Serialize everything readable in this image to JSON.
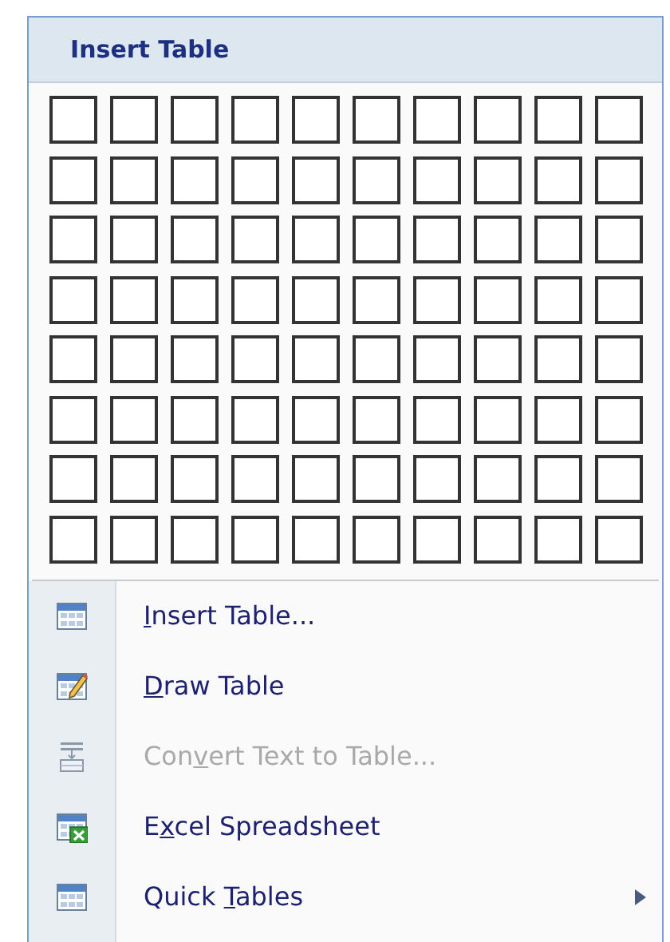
{
  "header": {
    "title": "Insert Table"
  },
  "grid": {
    "rows": [
      {
        "cells": [
          {
            "selected": false
          },
          {
            "selected": false
          },
          {
            "selected": false
          },
          {
            "selected": false
          },
          {
            "selected": false
          },
          {
            "selected": false
          },
          {
            "selected": false
          },
          {
            "selected": false
          },
          {
            "selected": false
          },
          {
            "selected": false
          }
        ]
      },
      {
        "cells": [
          {
            "selected": false
          },
          {
            "selected": false
          },
          {
            "selected": false
          },
          {
            "selected": false
          },
          {
            "selected": false
          },
          {
            "selected": false
          },
          {
            "selected": false
          },
          {
            "selected": false
          },
          {
            "selected": false
          },
          {
            "selected": false
          }
        ]
      },
      {
        "cells": [
          {
            "selected": false
          },
          {
            "selected": false
          },
          {
            "selected": false
          },
          {
            "selected": false
          },
          {
            "selected": false
          },
          {
            "selected": false
          },
          {
            "selected": false
          },
          {
            "selected": false
          },
          {
            "selected": false
          },
          {
            "selected": false
          }
        ]
      },
      {
        "cells": [
          {
            "selected": false
          },
          {
            "selected": false
          },
          {
            "selected": false
          },
          {
            "selected": false
          },
          {
            "selected": false
          },
          {
            "selected": false
          },
          {
            "selected": false
          },
          {
            "selected": false
          },
          {
            "selected": false
          },
          {
            "selected": false
          }
        ]
      },
      {
        "cells": [
          {
            "selected": false
          },
          {
            "selected": false
          },
          {
            "selected": false
          },
          {
            "selected": false
          },
          {
            "selected": false
          },
          {
            "selected": false
          },
          {
            "selected": false
          },
          {
            "selected": false
          },
          {
            "selected": false
          },
          {
            "selected": false
          }
        ]
      },
      {
        "cells": [
          {
            "selected": false
          },
          {
            "selected": false
          },
          {
            "selected": false
          },
          {
            "selected": false
          },
          {
            "selected": false
          },
          {
            "selected": false
          },
          {
            "selected": false
          },
          {
            "selected": false
          },
          {
            "selected": false
          },
          {
            "selected": false
          }
        ]
      },
      {
        "cells": [
          {
            "selected": false
          },
          {
            "selected": false
          },
          {
            "selected": false
          },
          {
            "selected": false
          },
          {
            "selected": false
          },
          {
            "selected": false
          },
          {
            "selected": false
          },
          {
            "selected": false
          },
          {
            "selected": false
          },
          {
            "selected": false
          }
        ]
      },
      {
        "cells": [
          {
            "selected": false
          },
          {
            "selected": false
          },
          {
            "selected": false
          },
          {
            "selected": false
          },
          {
            "selected": false
          },
          {
            "selected": false
          },
          {
            "selected": false
          },
          {
            "selected": false
          },
          {
            "selected": false
          },
          {
            "selected": false
          }
        ]
      }
    ]
  },
  "menu_items": [
    {
      "kind": "insert",
      "access_key": "I",
      "label_after": "nsert Table...",
      "disabled": false,
      "submenu": false
    },
    {
      "kind": "draw",
      "access_key": "D",
      "label_after": "raw Table",
      "disabled": false,
      "submenu": false
    },
    {
      "kind": "convert",
      "label_before": "Con",
      "access_key": "v",
      "label_after": "ert Text to Table...",
      "disabled": true,
      "submenu": false
    },
    {
      "kind": "excel",
      "label_before": "E",
      "access_key": "x",
      "label_after": "cel Spreadsheet",
      "disabled": false,
      "submenu": false
    },
    {
      "kind": "quick",
      "label_before": "Quick ",
      "access_key": "T",
      "label_after": "ables",
      "disabled": false,
      "submenu": true
    }
  ]
}
